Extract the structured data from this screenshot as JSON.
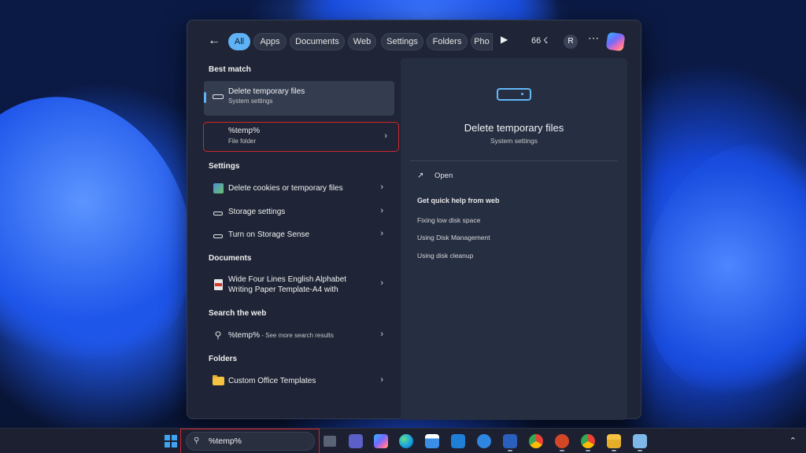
{
  "search_panel": {
    "filters": [
      "All",
      "Apps",
      "Documents",
      "Web",
      "Settings",
      "Folders",
      "Pho"
    ],
    "count": "66",
    "avatar_letter": "R",
    "sections": {
      "best_match": "Best match",
      "settings": "Settings",
      "documents": "Documents",
      "search_web": "Search the web",
      "folders": "Folders"
    },
    "best_match": {
      "title": "Delete temporary files",
      "subtitle": "System settings"
    },
    "temp_folder": {
      "title": "%temp%",
      "subtitle": "File folder"
    },
    "settings_items": [
      "Delete cookies or temporary files",
      "Storage settings",
      "Turn on Storage Sense"
    ],
    "document": {
      "line1": "Wide Four Lines English Alphabet",
      "line2": "Writing Paper Template-A4 with"
    },
    "web_search": {
      "query": "%temp%",
      "suffix": " - See more search results"
    },
    "folder_item": "Custom Office Templates",
    "detail": {
      "title": "Delete temporary files",
      "subtitle": "System settings",
      "open_label": "Open",
      "help_title": "Get quick help from web",
      "help_links": [
        "Fixing low disk space",
        "Using Disk Management",
        "Using disk cleanup"
      ]
    }
  },
  "taskbar": {
    "search_value": "%temp%",
    "apps": [
      "task-view",
      "teams",
      "copilot",
      "edge",
      "store",
      "weather",
      "photos",
      "word",
      "chrome",
      "powerpoint",
      "chrome-profile",
      "file-explorer",
      "snipping-tool"
    ]
  },
  "colors": {
    "accent": "#5fb2f5",
    "highlight_outline": "#d0262b",
    "panel_bg": "#1f2536"
  }
}
